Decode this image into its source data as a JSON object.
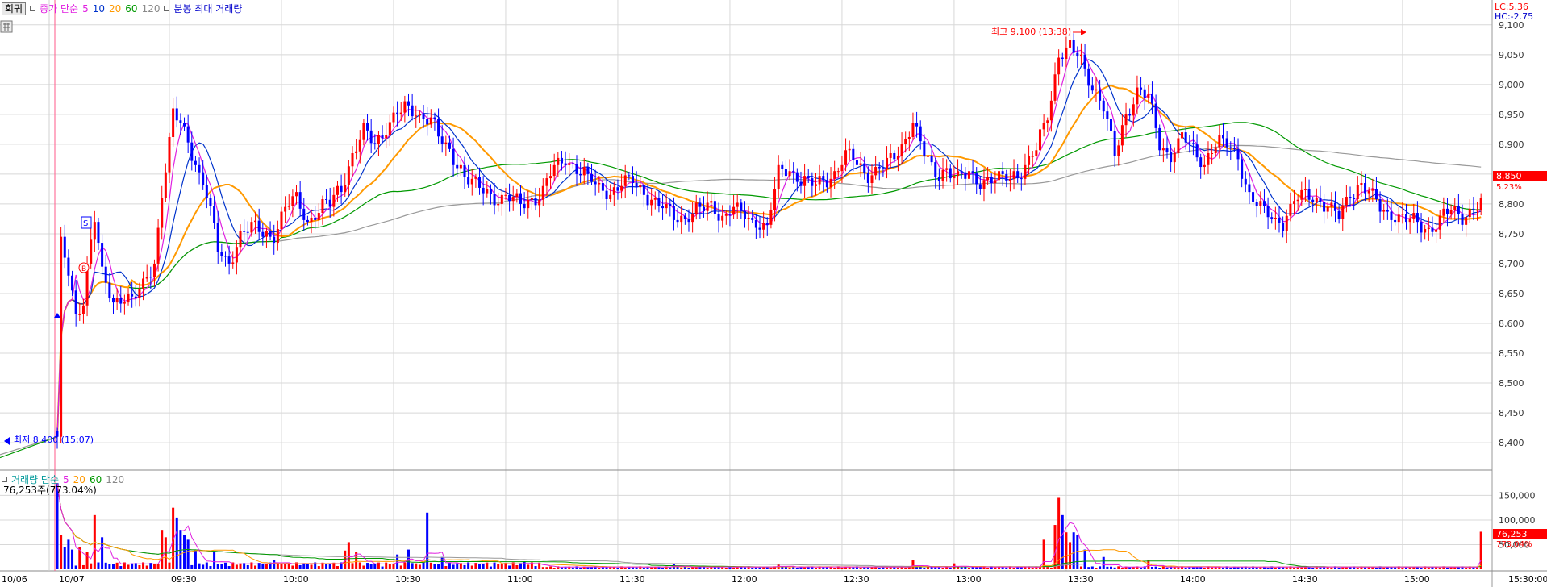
{
  "toolbar": {
    "reset_label": "회귀",
    "price_ma_label": "종가 단순",
    "ma_periods": [
      "5",
      "10",
      "20",
      "60",
      "120"
    ],
    "bar_max_label": "분봉 최대 거래량"
  },
  "volume_panel": {
    "title": "거래량 단순",
    "ma_periods": [
      "5",
      "20",
      "60",
      "120"
    ],
    "current_readout": "76,253주(773.04%)"
  },
  "colors": {
    "up": "#ff0000",
    "down": "#0000ff",
    "ma5": "#e020e0",
    "ma10": "#0033cc",
    "ma20": "#ff9900",
    "ma60": "#009900",
    "ma120": "#999999",
    "grid": "#d8d8d8"
  },
  "labels": {
    "lc": "LC:5.36",
    "hc": "HC:-2.75",
    "high_marker": "최고 9,100 (13:38)",
    "low_marker": "최저 8,400 (15:07)",
    "current_price": "8,850",
    "current_change": "5.23%",
    "current_volume": "76,253",
    "current_volume_pct": "773.04%",
    "signal_s": "S",
    "signal_b": "B"
  },
  "chart_data": [
    {
      "type": "candlestick",
      "title": "",
      "y_ticks": [
        "9,100",
        "9,050",
        "9,000",
        "8,950",
        "8,900",
        "8,850",
        "8,800",
        "8,750",
        "8,700",
        "8,650",
        "8,600",
        "8,550",
        "8,500",
        "8,450",
        "8,400"
      ],
      "ylim": [
        8365,
        9120
      ],
      "x_ticks": [
        {
          "t": -9,
          "label": "10/06"
        },
        {
          "t": 0,
          "label": "10/07"
        },
        {
          "t": 30,
          "label": "09:30"
        },
        {
          "t": 60,
          "label": "10:00"
        },
        {
          "t": 90,
          "label": "10:30"
        },
        {
          "t": 120,
          "label": "11:00"
        },
        {
          "t": 150,
          "label": "11:30"
        },
        {
          "t": 180,
          "label": "12:00"
        },
        {
          "t": 210,
          "label": "12:30"
        },
        {
          "t": 240,
          "label": "13:00"
        },
        {
          "t": 270,
          "label": "13:30"
        },
        {
          "t": 300,
          "label": "14:00"
        },
        {
          "t": 330,
          "label": "14:30"
        },
        {
          "t": 360,
          "label": "15:00"
        },
        {
          "t": 390,
          "label": "15:30:00"
        }
      ],
      "close_path": [
        [
          0,
          8410
        ],
        [
          1,
          8730
        ],
        [
          3,
          8680
        ],
        [
          5,
          8610
        ],
        [
          7,
          8640
        ],
        [
          8,
          8700
        ],
        [
          10,
          8780
        ],
        [
          12,
          8680
        ],
        [
          15,
          8630
        ],
        [
          18,
          8650
        ],
        [
          20,
          8640
        ],
        [
          23,
          8660
        ],
        [
          26,
          8700
        ],
        [
          28,
          8820
        ],
        [
          31,
          8950
        ],
        [
          34,
          8920
        ],
        [
          37,
          8870
        ],
        [
          40,
          8820
        ],
        [
          43,
          8720
        ],
        [
          46,
          8700
        ],
        [
          49,
          8750
        ],
        [
          52,
          8760
        ],
        [
          55,
          8750
        ],
        [
          58,
          8750
        ],
        [
          61,
          8790
        ],
        [
          64,
          8810
        ],
        [
          67,
          8770
        ],
        [
          70,
          8790
        ],
        [
          73,
          8800
        ],
        [
          76,
          8830
        ],
        [
          79,
          8880
        ],
        [
          82,
          8920
        ],
        [
          85,
          8900
        ],
        [
          88,
          8930
        ],
        [
          91,
          8950
        ],
        [
          94,
          8960
        ],
        [
          97,
          8950
        ],
        [
          100,
          8940
        ],
        [
          103,
          8900
        ],
        [
          106,
          8880
        ],
        [
          109,
          8850
        ],
        [
          112,
          8830
        ],
        [
          115,
          8820
        ],
        [
          118,
          8810
        ],
        [
          121,
          8810
        ],
        [
          124,
          8800
        ],
        [
          127,
          8810
        ],
        [
          130,
          8820
        ],
        [
          133,
          8860
        ],
        [
          136,
          8880
        ],
        [
          139,
          8860
        ],
        [
          142,
          8840
        ],
        [
          145,
          8830
        ],
        [
          148,
          8820
        ],
        [
          151,
          8830
        ],
        [
          154,
          8840
        ],
        [
          157,
          8820
        ],
        [
          160,
          8800
        ],
        [
          163,
          8790
        ],
        [
          166,
          8780
        ],
        [
          169,
          8780
        ],
        [
          172,
          8790
        ],
        [
          175,
          8800
        ],
        [
          178,
          8780
        ],
        [
          181,
          8790
        ],
        [
          184,
          8780
        ],
        [
          187,
          8770
        ],
        [
          190,
          8760
        ],
        [
          193,
          8850
        ],
        [
          196,
          8860
        ],
        [
          199,
          8840
        ],
        [
          202,
          8830
        ],
        [
          205,
          8840
        ],
        [
          208,
          8850
        ],
        [
          211,
          8880
        ],
        [
          214,
          8870
        ],
        [
          217,
          8850
        ],
        [
          220,
          8860
        ],
        [
          223,
          8870
        ],
        [
          226,
          8900
        ],
        [
          229,
          8940
        ],
        [
          232,
          8880
        ],
        [
          235,
          8850
        ],
        [
          238,
          8860
        ],
        [
          241,
          8840
        ],
        [
          244,
          8850
        ],
        [
          247,
          8840
        ],
        [
          250,
          8840
        ],
        [
          253,
          8840
        ],
        [
          256,
          8850
        ],
        [
          259,
          8860
        ],
        [
          262,
          8890
        ],
        [
          265,
          8950
        ],
        [
          268,
          9050
        ],
        [
          271,
          9060
        ],
        [
          274,
          9040
        ],
        [
          277,
          9000
        ],
        [
          280,
          8960
        ],
        [
          283,
          8880
        ],
        [
          286,
          8950
        ],
        [
          289,
          8990
        ],
        [
          292,
          8980
        ],
        [
          295,
          8900
        ],
        [
          298,
          8880
        ],
        [
          301,
          8910
        ],
        [
          304,
          8890
        ],
        [
          307,
          8870
        ],
        [
          310,
          8900
        ],
        [
          313,
          8900
        ],
        [
          316,
          8880
        ],
        [
          319,
          8810
        ],
        [
          322,
          8790
        ],
        [
          325,
          8780
        ],
        [
          328,
          8770
        ],
        [
          331,
          8800
        ],
        [
          334,
          8820
        ],
        [
          337,
          8810
        ],
        [
          340,
          8790
        ],
        [
          343,
          8780
        ],
        [
          346,
          8820
        ],
        [
          349,
          8830
        ],
        [
          352,
          8810
        ],
        [
          355,
          8790
        ],
        [
          358,
          8780
        ],
        [
          361,
          8770
        ],
        [
          364,
          8770
        ],
        [
          367,
          8760
        ],
        [
          370,
          8770
        ],
        [
          373,
          8790
        ],
        [
          376,
          8780
        ],
        [
          379,
          8790
        ],
        [
          381,
          8800
        ]
      ],
      "high": {
        "t": 269,
        "value": 9100,
        "time": "13:38"
      },
      "low": {
        "t": -1,
        "value": 8400,
        "time": "15:07"
      },
      "last": {
        "value": 8850,
        "change_pct": 5.23
      }
    },
    {
      "type": "bar",
      "title": "거래량",
      "y_ticks": [
        "150,000",
        "100,000",
        "50,000"
      ],
      "ylim": [
        0,
        190000
      ],
      "spikes": [
        [
          0,
          175000
        ],
        [
          1,
          70000
        ],
        [
          2,
          45000
        ],
        [
          3,
          60000
        ],
        [
          4,
          40000
        ],
        [
          6,
          45000
        ],
        [
          8,
          35000
        ],
        [
          10,
          110000
        ],
        [
          12,
          65000
        ],
        [
          28,
          80000
        ],
        [
          29,
          65000
        ],
        [
          31,
          125000
        ],
        [
          32,
          105000
        ],
        [
          33,
          80000
        ],
        [
          34,
          70000
        ],
        [
          35,
          60000
        ],
        [
          37,
          40000
        ],
        [
          42,
          35000
        ],
        [
          58,
          18000
        ],
        [
          77,
          38000
        ],
        [
          78,
          55000
        ],
        [
          80,
          35000
        ],
        [
          91,
          30000
        ],
        [
          94,
          40000
        ],
        [
          99,
          115000
        ],
        [
          103,
          25000
        ],
        [
          125,
          15000
        ],
        [
          165,
          12000
        ],
        [
          193,
          10000
        ],
        [
          229,
          18000
        ],
        [
          240,
          12000
        ],
        [
          264,
          60000
        ],
        [
          267,
          90000
        ],
        [
          268,
          145000
        ],
        [
          269,
          110000
        ],
        [
          270,
          75000
        ],
        [
          271,
          55000
        ],
        [
          272,
          75000
        ],
        [
          273,
          70000
        ],
        [
          275,
          40000
        ],
        [
          280,
          25000
        ],
        [
          292,
          18000
        ],
        [
          381,
          76253
        ]
      ],
      "last": {
        "value": 76253,
        "pct": 773.04
      }
    }
  ]
}
